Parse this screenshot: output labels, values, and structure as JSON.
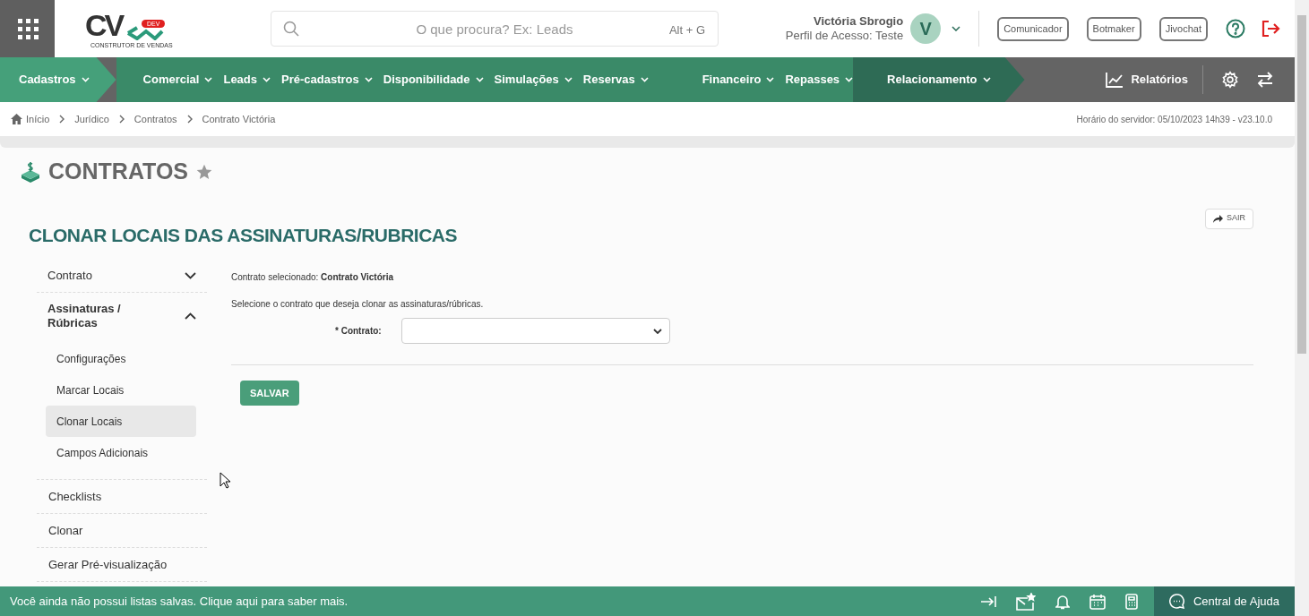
{
  "logo": {
    "letters": "CV",
    "badge": "DEV",
    "tagline": "CONSTRUTOR DE VENDAS"
  },
  "search": {
    "placeholder": "O que procura? Ex: Leads",
    "shortcut": "Alt + G"
  },
  "user": {
    "name": "Victória Sbrogio",
    "profile": "Perfil de Acesso: Teste",
    "initial": "V"
  },
  "header_buttons": [
    "Comunicador",
    "Botmaker",
    "Jivochat"
  ],
  "nav": [
    {
      "label": "Cadastros",
      "color": "#45a07a"
    },
    {
      "label": "Comercial",
      "color": "#3a8a68"
    },
    {
      "label": "Leads",
      "color": "#3a8a68"
    },
    {
      "label": "Pré-cadastros",
      "color": "#3a8a68"
    },
    {
      "label": "Disponibilidade",
      "color": "#3a8a68"
    },
    {
      "label": "Simulações",
      "color": "#3a8a68"
    },
    {
      "label": "Reservas",
      "color": "#3a8a68"
    },
    {
      "label": "Financeiro",
      "color": "#3a8a68"
    },
    {
      "label": "Repasses",
      "color": "#3a8a68"
    },
    {
      "label": "Relacionamento",
      "color": "#2e6b55"
    }
  ],
  "nav_reports": "Relatórios",
  "breadcrumb": [
    "Início",
    "Jurídico",
    "Contratos",
    "Contrato Victória"
  ],
  "server_time": "Horário do servidor: 05/10/2023 14h39 - v23.10.0",
  "page_title": "CONTRATOS",
  "section_title": "CLONAR LOCAIS DAS ASSINATURAS/RUBRICAS",
  "exit_button": "SAIR",
  "sidebar": [
    {
      "label": "Contrato",
      "kind": "group",
      "expanded": false
    },
    {
      "label": "Assinaturas / Rúbricas",
      "kind": "group",
      "expanded": true,
      "children": [
        {
          "label": "Configurações",
          "selected": false
        },
        {
          "label": "Marcar Locais",
          "selected": false
        },
        {
          "label": "Clonar Locais",
          "selected": true
        },
        {
          "label": "Campos Adicionais",
          "selected": false
        }
      ]
    },
    {
      "label": "Checklists",
      "kind": "link"
    },
    {
      "label": "Clonar",
      "kind": "link"
    },
    {
      "label": "Gerar Pré-visualização",
      "kind": "link"
    }
  ],
  "form": {
    "selected_label": "Contrato selecionado:",
    "selected_value": "Contrato Victória",
    "instruction": "Selecione o contrato que deseja clonar as assinaturas/rúbricas.",
    "field_label": "* Contrato:",
    "save_button": "SALVAR"
  },
  "footer": {
    "message": "Você ainda não possui listas salvas. Clique aqui para saber mais.",
    "help": "Central de Ajuda"
  }
}
